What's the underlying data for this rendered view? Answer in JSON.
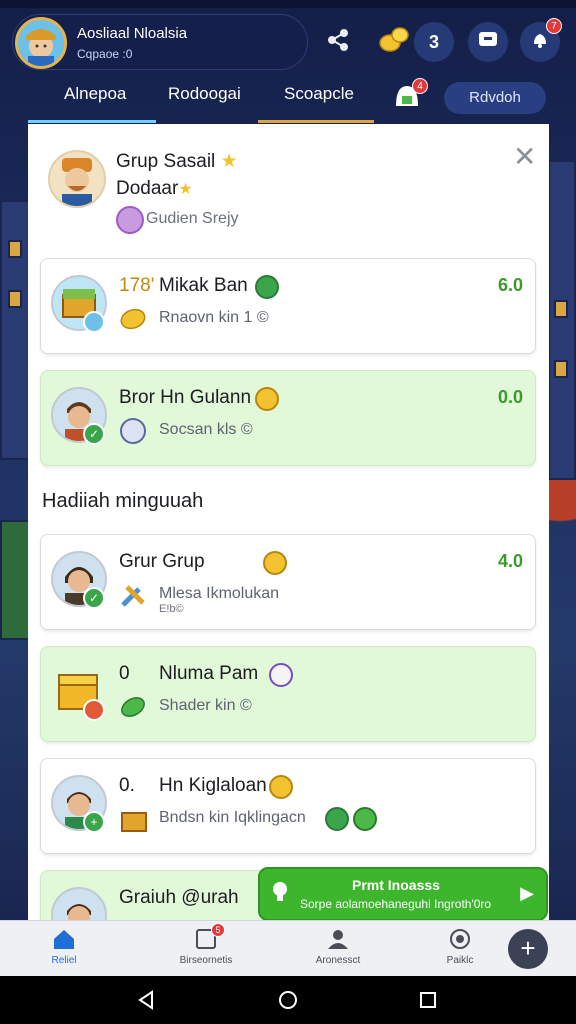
{
  "header": {
    "profile_name": "Aosliaal Nloalsia",
    "profile_sub": "Cqpaoe :0",
    "notif_count": "7"
  },
  "tabs": {
    "items": [
      "Alnepoa",
      "Rodoogai",
      "Scoapcle"
    ],
    "pill_label": "Rdvdoh",
    "gift_badge": "4"
  },
  "group": {
    "title_line1": "Grup  Sasail",
    "title_line2": "Dodaar",
    "subtitle": "Gudien Srejy"
  },
  "cards_top": [
    {
      "prefix": "178'",
      "title": "Mikak Ban",
      "sub": "Rnaovn kin 1 ©",
      "value": "6.0"
    },
    {
      "prefix": "",
      "title": "Bror Hn Gulann",
      "sub": "Socsan kls ©",
      "value": "0.0"
    }
  ],
  "section_title": "Hadiiah minguuah",
  "cards_bottom": [
    {
      "prefix": "",
      "title": "Grur Grup",
      "sub": "Mlesa Ikmolukan",
      "sub2": "E!b©",
      "value": "4.0"
    },
    {
      "prefix": "0",
      "title": "Nluma Pam",
      "sub": "Shader kin ©",
      "value": ""
    },
    {
      "prefix": "0.",
      "title": "Hn Kiglaloan",
      "sub": "Bndsn kin Iqklingacn",
      "value": ""
    },
    {
      "prefix": "",
      "title": "Graiuh @urah",
      "sub": "",
      "value": ""
    }
  ],
  "toast": {
    "title": "Prmt Inoasss",
    "subtitle": "Sorpe aolamoehaneguhi Ingroth'0ro"
  },
  "bottom_nav": {
    "items": [
      "Reliel",
      "Birseornetis",
      "Aronessct",
      "Paiklc"
    ],
    "badge": "5"
  },
  "colors": {
    "accent": "#3db62e",
    "header_bg": "#1d2f63",
    "value_green": "#3a9a2a"
  }
}
